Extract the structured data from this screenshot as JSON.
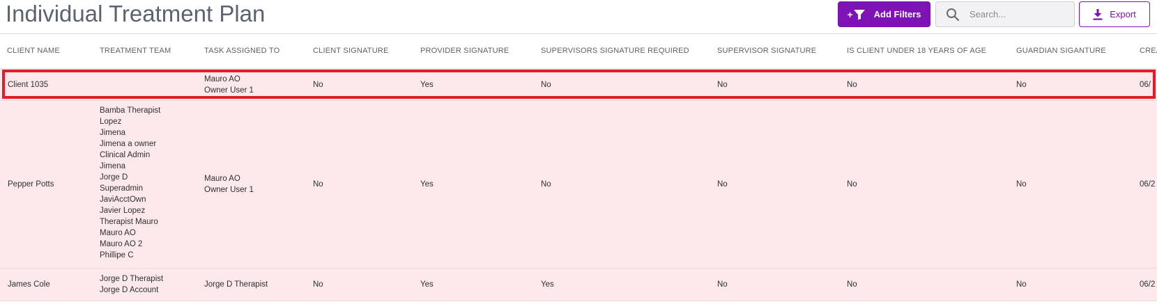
{
  "page": {
    "title": "Individual Treatment Plan"
  },
  "toolbar": {
    "add_filters_label": "Add Filters",
    "add_filters_plus": "+",
    "search_placeholder": "Search...",
    "export_label": "Export",
    "accent_color": "#7d12b5"
  },
  "table": {
    "headers": [
      "CLIENT NAME",
      "TREATMENT TEAM",
      "TASK ASSIGNED TO",
      "CLIENT SIGNATURE",
      "PROVIDER SIGNATURE",
      "SUPERVISORS SIGNATURE REQUIRED",
      "SUPERVISOR SIGNATURE",
      "IS CLIENT UNDER 18 YEARS OF AGE",
      "GUARDIAN SIGANTURE",
      "CREA"
    ],
    "rows": [
      {
        "client_name": "Client 1035",
        "treatment_team": [],
        "task_assigned_to": [
          "Mauro AO",
          "Owner User 1"
        ],
        "client_signature": "No",
        "provider_signature": "Yes",
        "supervisors_signature_required": "No",
        "supervisor_signature": "No",
        "client_under_18": "No",
        "guardian_signature": "No",
        "created": "06/",
        "selected": true
      },
      {
        "client_name": "Pepper Potts",
        "treatment_team": [
          "Bamba Therapist",
          "Lopez",
          "Jimena",
          "Jimena a owner",
          "Clinical Admin",
          "Jimena",
          "Jorge D",
          "Superadmin",
          "JaviAcctOwn",
          "Javier Lopez",
          "Therapist Mauro",
          "Mauro AO",
          "Mauro AO 2",
          "Phillipe C"
        ],
        "task_assigned_to": [
          "Mauro AO",
          "Owner User 1"
        ],
        "client_signature": "No",
        "provider_signature": "Yes",
        "supervisors_signature_required": "No",
        "supervisor_signature": "No",
        "client_under_18": "No",
        "guardian_signature": "No",
        "created": "06/2",
        "selected": false
      },
      {
        "client_name": "James Cole",
        "treatment_team": [
          "Jorge D Therapist",
          "Jorge D Account"
        ],
        "task_assigned_to": [
          "Jorge D Therapist"
        ],
        "client_signature": "No",
        "provider_signature": "Yes",
        "supervisors_signature_required": "Yes",
        "supervisor_signature": "No",
        "client_under_18": "No",
        "guardian_signature": "No",
        "created": "06/2",
        "selected": false
      }
    ],
    "row_background": "#fde9ec",
    "selection_color": "#e21d25"
  }
}
